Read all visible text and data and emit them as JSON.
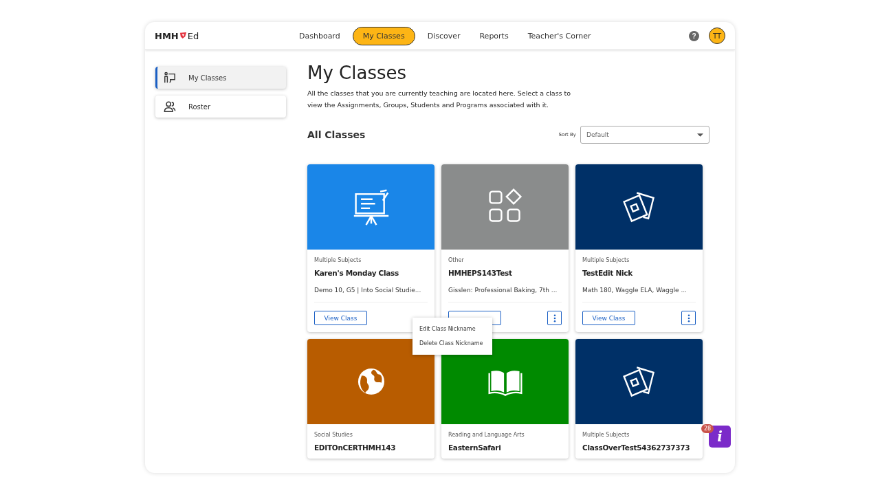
{
  "header": {
    "logo_text": "HMH",
    "logo_suffix": "Ed",
    "nav": [
      {
        "label": "Dashboard",
        "selected": false
      },
      {
        "label": "My Classes",
        "selected": true
      },
      {
        "label": "Discover",
        "selected": false
      },
      {
        "label": "Reports",
        "selected": false
      },
      {
        "label": "Teacher's Corner",
        "selected": false
      }
    ],
    "help": "?",
    "avatar": "TT"
  },
  "sidebar": {
    "items": [
      {
        "label": "My Classes",
        "kind": "teacher",
        "selected": true
      },
      {
        "label": "Roster",
        "kind": "people",
        "selected": false
      }
    ]
  },
  "main": {
    "title": "My Classes",
    "intro": "All the classes that you are currently teaching are located here. Select a class to view the Assignments, Groups, Students and Programs associated with it.",
    "section_title": "All Classes",
    "sort_label": "Sort By",
    "sort_value": "Default"
  },
  "cards": [
    {
      "kind": "easel",
      "color": "#1a86e8",
      "subject": "Multiple Subjects",
      "name": "Karen's Monday Class",
      "programs": "Demo 10, G5 | Into Social Studie...",
      "view_label": "View Class",
      "menu_button": false
    },
    {
      "kind": "shapes",
      "color": "#8a8c8c",
      "subject": "Other",
      "name": "HMHEPS143Test",
      "programs": "Gisslen: Professional Baking, 7th ...",
      "menu_button": true
    },
    {
      "kind": "cards",
      "color": "#003067",
      "subject": "Multiple Subjects",
      "name": "TestEdit Nick",
      "programs": "Math 180, Waggle ELA, Waggle ...",
      "view_label": "View Class",
      "menu_button": true
    },
    {
      "kind": "globe",
      "color": "#b85c00",
      "subject": "Social Studies",
      "name": "EDITOnCERTHMH143"
    },
    {
      "kind": "book",
      "color": "#008a00",
      "subject": "Reading and Language Arts",
      "name": "EasternSafari"
    },
    {
      "kind": "cards",
      "color": "#003067",
      "subject": "Multiple Subjects",
      "name": "ClassOverTest54362737373"
    }
  ],
  "context_menu": {
    "items": [
      "Edit Class Nickname",
      "Delete Class Nickname"
    ]
  },
  "info_button": {
    "badge": "28",
    "label": "i"
  }
}
